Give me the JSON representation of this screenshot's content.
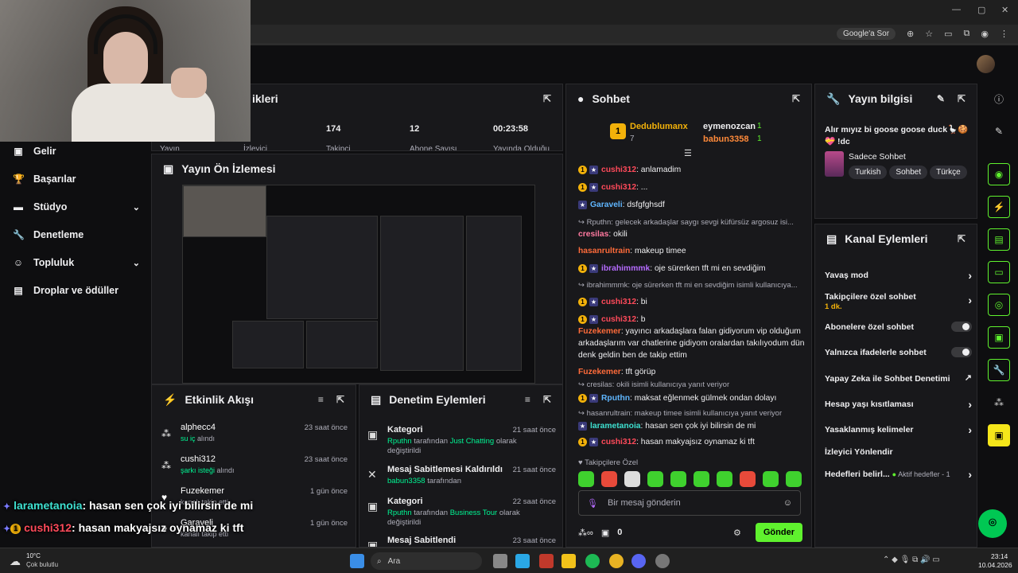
{
  "browser": {
    "google_chip": "Google'a Sor"
  },
  "sidebar": {
    "items": [
      {
        "label": "Gelir",
        "icon": "money-icon"
      },
      {
        "label": "Başarılar",
        "icon": "trophy-icon"
      },
      {
        "label": "Stüdyo",
        "icon": "video-icon"
      },
      {
        "label": "Denetleme",
        "icon": "wrench-icon"
      },
      {
        "label": "Topluluk",
        "icon": "people-icon"
      },
      {
        "label": "Droplar ve ödüller",
        "icon": "gift-icon"
      }
    ]
  },
  "stats": {
    "title": "ikleri",
    "items": [
      {
        "value": "",
        "label": "Yayın"
      },
      {
        "value": "",
        "label": "İzleyici"
      },
      {
        "value": "174",
        "label": "Takipçi"
      },
      {
        "value": "12",
        "label": "Abone Sayısı"
      },
      {
        "value": "00:23:58",
        "label": "Yayında Olduğu"
      }
    ]
  },
  "preview": {
    "title": "Yayın Ön İzlemesi"
  },
  "activity": {
    "title": "Etkinlik Akışı",
    "items": [
      {
        "name": "alphecc4",
        "highlight": "su iç",
        "suffix": "alındı",
        "time": "23 saat önce"
      },
      {
        "name": "cushi312",
        "highlight": "şarkı isteği",
        "suffix": "alındı",
        "time": "23 saat önce"
      },
      {
        "name": "Fuzekemer",
        "highlight": "",
        "suffix": "kanalı takip etti",
        "time": "1 gün önce"
      },
      {
        "name": "Garaveli",
        "highlight": "",
        "suffix": "kanalı takip etti",
        "time": "1 gün önce"
      }
    ]
  },
  "moderation": {
    "title": "Denetim Eylemleri",
    "items": [
      {
        "title": "Kategori",
        "time": "21 saat önce",
        "user": "Rputhn",
        "mid": "tarafından",
        "highlight": "Just Chatting",
        "tail": "olarak değiştirildi"
      },
      {
        "title": "Mesaj Sabitlemesi Kaldırıldı",
        "time": "21 saat önce",
        "user": "babun3358",
        "mid": "tarafından",
        "highlight": "",
        "tail": ""
      },
      {
        "title": "Kategori",
        "time": "22 saat önce",
        "user": "Rputhn",
        "mid": "tarafından",
        "highlight": "Business Tour",
        "tail": "olarak değiştirildi"
      },
      {
        "title": "Mesaj Sabitlendi",
        "time": "23 saat önce",
        "user": "",
        "mid": "",
        "highlight": "",
        "tail": ""
      }
    ]
  },
  "chat": {
    "title": "Sohbet",
    "leader": {
      "rank": "1",
      "name": "Dedublumanx",
      "points": "7"
    },
    "top": [
      {
        "name": "eymenozcan",
        "points": "1"
      },
      {
        "name": "babun3358",
        "points": "1"
      }
    ],
    "messages": [
      {
        "type": "msg",
        "user": "cushi312",
        "color": "#ff4a5a",
        "text": ": anlamadim",
        "badges": 2
      },
      {
        "type": "msg",
        "user": "cushi312",
        "color": "#ff4a5a",
        "text": ": ...",
        "badges": 2
      },
      {
        "type": "msg",
        "user": "Garaveli",
        "color": "#5fb6ff",
        "text": ": dsfgfghsdf",
        "badges": 1
      },
      {
        "type": "reply",
        "text": "Rputhn: gelecek arkadaşlar saygı sevgi küfürsüz argosuz isi..."
      },
      {
        "type": "msg",
        "user": "cresilas",
        "color": "#ff7aa0",
        "text": ": okili",
        "badges": 0
      },
      {
        "type": "msg",
        "user": "hasanrultrain",
        "color": "#ff6b3a",
        "text": ": makeup timee",
        "badges": 0
      },
      {
        "type": "msg",
        "user": "ibrahimmmk",
        "color": "#b56bff",
        "text": ": oje sürerken tft mi en sevdiğim",
        "badges": 2
      },
      {
        "type": "reply",
        "text": "ibrahimmmk: oje sürerken tft mi en sevdiğim isimli kullanıcıya..."
      },
      {
        "type": "msg",
        "user": "cushi312",
        "color": "#ff4a5a",
        "text": ": bi",
        "badges": 2
      },
      {
        "type": "msg",
        "user": "cushi312",
        "color": "#ff4a5a",
        "text": ": b",
        "badges": 2
      },
      {
        "type": "msg",
        "user": "Fuzekemer",
        "color": "#ff6b3a",
        "text": ": yayıncı arkadaşlara falan gidiyorum vip olduğum arkadaşlarım var chatlerine gidiyom oralardan takılıyodum dün denk geldin ben de takip ettim",
        "badges": 0
      },
      {
        "type": "msg",
        "user": "Fuzekemer",
        "color": "#ff6b3a",
        "text": ": tft görüp",
        "badges": 0
      },
      {
        "type": "reply",
        "text": "cresilas: okili isimli kullanıcıya yanıt veriyor"
      },
      {
        "type": "msg",
        "user": "Rputhn",
        "color": "#5fb6ff",
        "text": ": maksat eğlenmek gülmek ondan dolayı",
        "badges": 2
      },
      {
        "type": "reply",
        "text": "hasanrultrain: makeup timee isimli kullanıcıya yanıt veriyor"
      },
      {
        "type": "msg",
        "user": "larametanoia",
        "color": "#3ee0d0",
        "text": ": hasan sen çok iyi bilirsin de mi",
        "badges": 1
      },
      {
        "type": "msg",
        "user": "cushi312",
        "color": "#ff4a5a",
        "text": ": hasan makyajsız oynamaz ki tft",
        "badges": 2
      }
    ],
    "followers_only": "Takipçilere Özel",
    "input_placeholder": "Bir mesaj gönderin",
    "points": "0",
    "send": "Gönder"
  },
  "stream_info": {
    "title": "Yayın bilgisi",
    "stream_title": "Alır mıyız bi goose goose duck🪿🍪💝 !dc",
    "category": "Sadece Sohbet",
    "tags": [
      "Turkish",
      "Sohbet",
      "Türkçe"
    ]
  },
  "channel_actions": {
    "title": "Kanal Eylemleri",
    "items": [
      {
        "label": "Yavaş mod",
        "sub": "",
        "control": "chevron"
      },
      {
        "label": "Takipçilere özel sohbet",
        "sub": "1 dk.",
        "control": "chevron"
      },
      {
        "label": "Abonelere özel sohbet",
        "sub": "",
        "control": "toggle"
      },
      {
        "label": "Yalnızca ifadelerle sohbet",
        "sub": "",
        "control": "toggle"
      },
      {
        "label": "Yapay Zeka ile Sohbet Denetimi",
        "sub": "",
        "control": "external"
      },
      {
        "label": "Hesap yaşı kısıtlaması",
        "sub": "",
        "control": "chevron"
      },
      {
        "label": "Yasaklanmış kelimeler",
        "sub": "",
        "control": "chevron"
      },
      {
        "label": "İzleyici Yönlendir",
        "sub": "",
        "control": "none"
      },
      {
        "label": "Hedefleri belirl...",
        "sub": "Aktif hedefler - 1",
        "control": "chevron"
      }
    ]
  },
  "overlay": [
    {
      "user": "larametanoia",
      "text": ": hasan sen çok iyi bilirsin de mi"
    },
    {
      "user": "cushi312",
      "text": ": hasan makyajsız oynamaz ki tft"
    }
  ],
  "taskbar": {
    "weather_temp": "10°C",
    "weather_desc": "Çok bulutlu",
    "search": "Ara",
    "time": "23:14",
    "date": "10.04.2026"
  },
  "colors": {
    "accent_green": "#5ff22e",
    "panel_bg": "#18181b",
    "page_bg": "#0e0e10"
  }
}
